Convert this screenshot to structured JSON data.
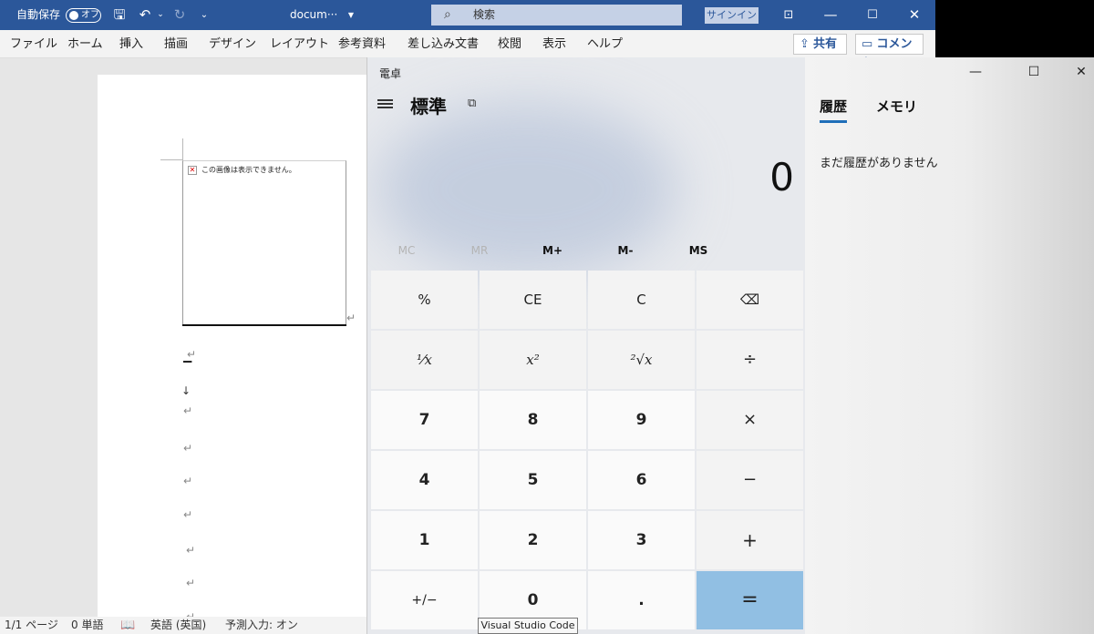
{
  "word": {
    "titlebar": {
      "autosave_label": "自動保存",
      "autosave_state": "オフ",
      "document_name": "docum···",
      "search_placeholder": "検索",
      "signin": "サインイン"
    },
    "tabs": [
      "ファイル",
      "ホーム",
      "挿入",
      "描画",
      "デザイン",
      "レイアウト",
      "参考資料",
      "差し込み文書",
      "校閲",
      "表示",
      "ヘルプ"
    ],
    "share_label": "共有",
    "comment_label": "コメント",
    "broken_image_text": "この画像は表示できません。",
    "status": {
      "page": "1/1 ページ",
      "words": "0 単語",
      "language": "英語 (英国)",
      "prediction": "予測入力: オン"
    }
  },
  "calculator": {
    "title": "電卓",
    "mode": "標準",
    "display": "0",
    "memory_buttons": [
      {
        "label": "MC",
        "enabled": false
      },
      {
        "label": "MR",
        "enabled": false
      },
      {
        "label": "M+",
        "enabled": true
      },
      {
        "label": "M-",
        "enabled": true
      },
      {
        "label": "MS",
        "enabled": true
      }
    ],
    "keys": {
      "percent": "%",
      "ce": "CE",
      "c": "C",
      "backspace": "⌫",
      "reciprocal": "¹⁄x",
      "square": "x²",
      "sqrt": "²√x",
      "divide": "÷",
      "seven": "7",
      "eight": "8",
      "nine": "9",
      "multiply": "×",
      "four": "4",
      "five": "5",
      "six": "6",
      "minus": "−",
      "one": "1",
      "two": "2",
      "three": "3",
      "plus": "+",
      "negate": "+/−",
      "zero": "0",
      "decimal": ".",
      "equals": "="
    },
    "history_tab": "履歴",
    "memory_tab": "メモリ",
    "history_empty": "まだ履歴がありません"
  },
  "tooltip": "Visual Studio Code",
  "colors": {
    "word_blue": "#2b579a",
    "equals_key": "#91bfe3",
    "tab_underline": "#1f6fb9"
  }
}
